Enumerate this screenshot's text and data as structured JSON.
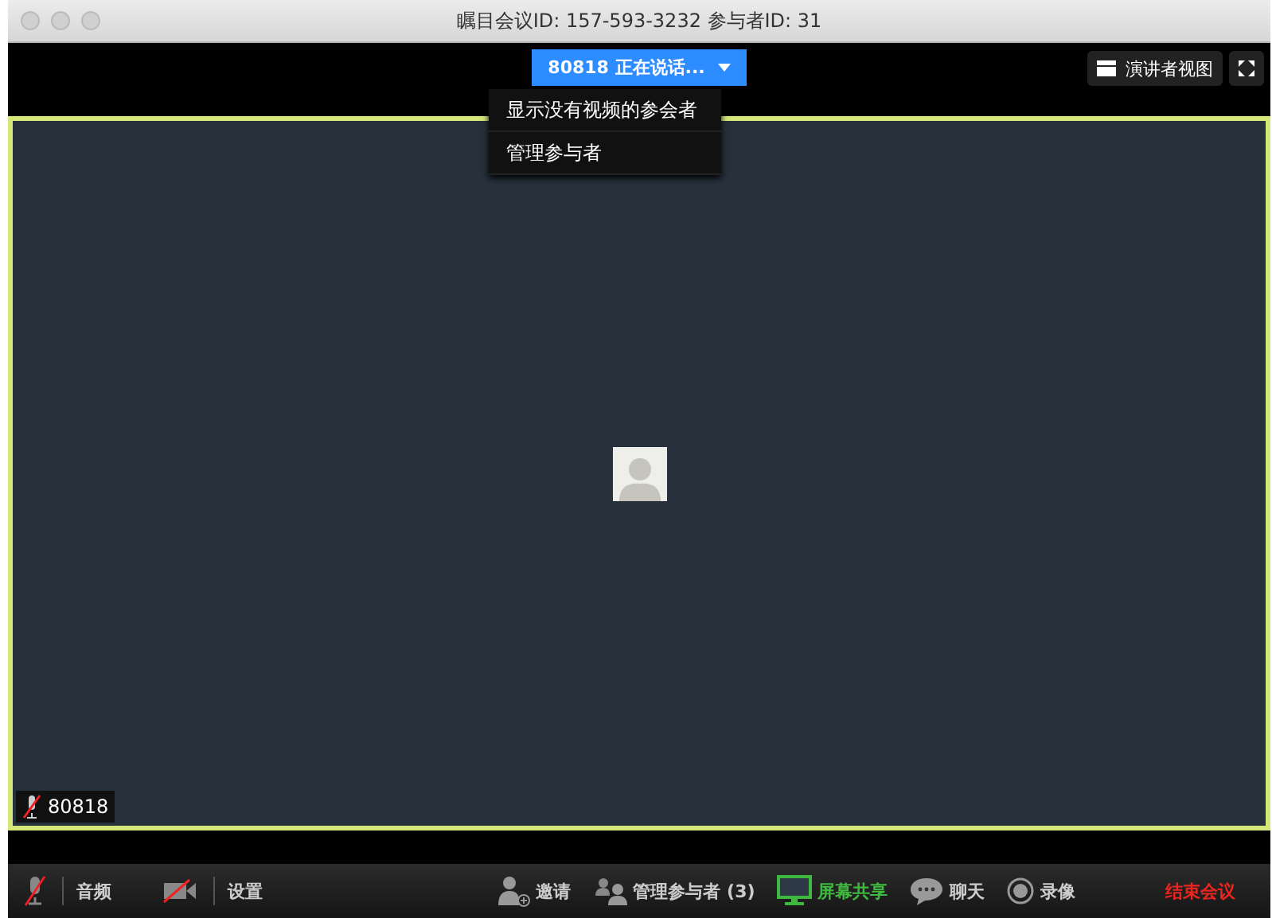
{
  "window": {
    "title": "瞩目会议ID: 157-593-3232 参与者ID: 31"
  },
  "speaker_button": {
    "label": "80818 正在说话..."
  },
  "dropdown": {
    "items": [
      "显示没有视频的参会者",
      "管理参与者"
    ]
  },
  "presenter_view": {
    "label": "演讲者视图"
  },
  "participant": {
    "name": "80818",
    "muted": true
  },
  "toolbar": [
    {
      "kind": "mic",
      "label": "音频",
      "off": true
    },
    {
      "kind": "camera",
      "label": "设置",
      "off": true
    },
    {
      "kind": "invite",
      "label": "邀请"
    },
    {
      "kind": "participants",
      "label": "管理参与者 (3)"
    },
    {
      "kind": "share",
      "label": "屏幕共享"
    },
    {
      "kind": "chat",
      "label": "聊天"
    },
    {
      "kind": "record",
      "label": "录像"
    },
    {
      "kind": "end",
      "label": "结束会议"
    }
  ]
}
